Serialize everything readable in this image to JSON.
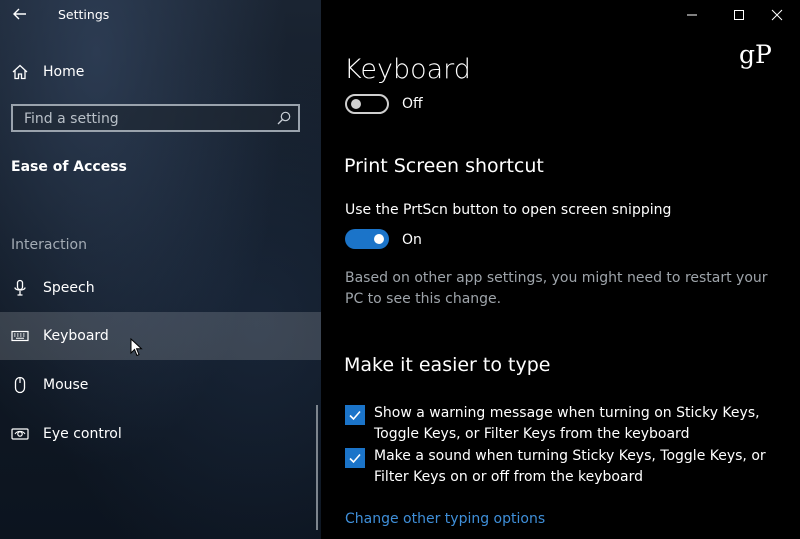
{
  "window": {
    "title": "Settings",
    "controls": [
      "minimize",
      "maximize",
      "close"
    ]
  },
  "sidebar": {
    "home_label": "Home",
    "search_placeholder": "Find a setting",
    "section_heading": "Ease of Access",
    "group_label": "Interaction",
    "items": [
      {
        "label": "Speech",
        "icon": "microphone-icon",
        "selected": false
      },
      {
        "label": "Keyboard",
        "icon": "keyboard-icon",
        "selected": true
      },
      {
        "label": "Mouse",
        "icon": "mouse-icon",
        "selected": false
      },
      {
        "label": "Eye control",
        "icon": "eye-control-icon",
        "selected": false
      }
    ]
  },
  "logo": "gP",
  "main": {
    "page_title": "Keyboard",
    "top_toggle_state": "Off",
    "print_screen": {
      "heading": "Print Screen shortcut",
      "description": "Use the PrtScn button to open screen snipping",
      "toggle_state": "On",
      "note": "Based on other app settings, you might need to restart your PC to see this change."
    },
    "typing": {
      "heading": "Make it easier to type",
      "checkboxes": [
        {
          "label": "Show a warning message when turning on Sticky Keys, Toggle Keys, or Filter Keys from the keyboard",
          "checked": true
        },
        {
          "label": "Make a sound when turning Sticky Keys, Toggle Keys, or Filter Keys on or off from the keyboard",
          "checked": true
        }
      ],
      "link": "Change other typing options"
    }
  },
  "colors": {
    "accent": "#1b74c9",
    "link": "#3f8fd9"
  }
}
